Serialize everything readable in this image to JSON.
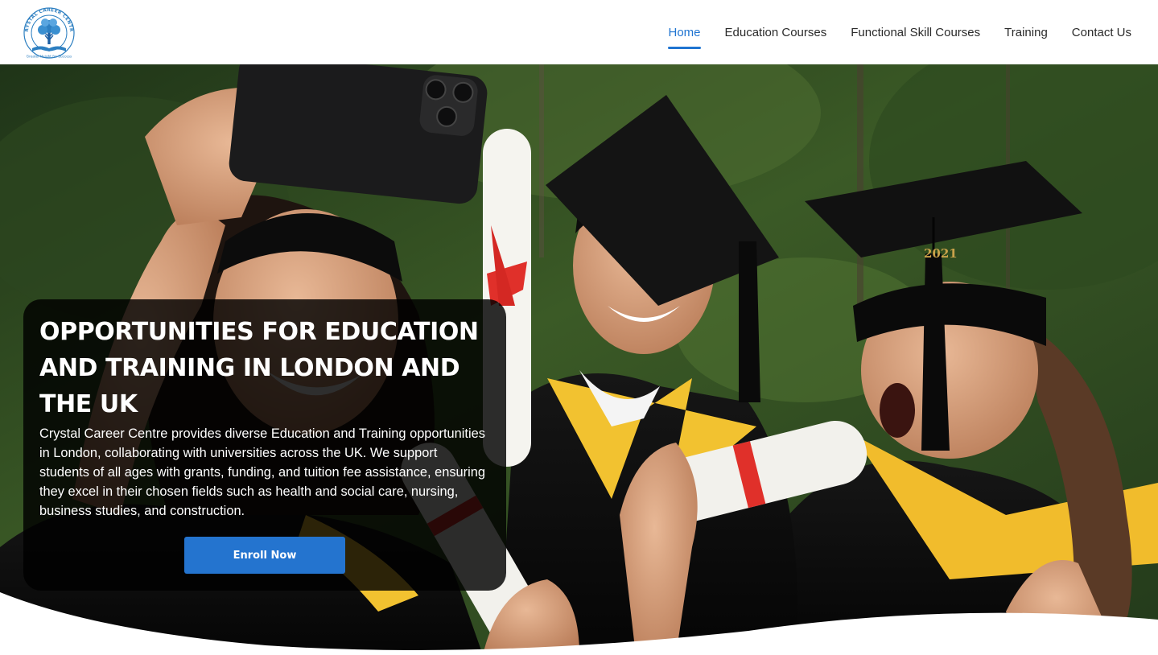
{
  "logo": {
    "ring_text": "CRYSTAL CAREER CENTRE",
    "tagline": "Greater Height for Success"
  },
  "nav": {
    "items": [
      {
        "label": "Home",
        "active": true
      },
      {
        "label": "Education Courses",
        "active": false
      },
      {
        "label": "Functional Skill Courses",
        "active": false
      },
      {
        "label": "Training",
        "active": false
      },
      {
        "label": "Contact Us",
        "active": false
      }
    ]
  },
  "hero": {
    "title": "OPPORTUNITIES FOR EDUCATION AND TRAINING IN LONDON AND THE UK",
    "description": "Crystal Career Centre provides diverse Education and Training opportunities in London, collaborating with universities across the UK. We support students of all ages with grants, funding, and tuition fee assistance, ensuring they excel in their chosen fields such as health and social care, nursing, business studies, and construction.",
    "button_label": "Enroll Now",
    "cap_tassel_text": "2021"
  },
  "colors": {
    "accent": "#1f74d1",
    "button": "#2474cf",
    "nav_text": "#2a2a2a",
    "card_bg": "rgba(0,0,0,0.82)"
  }
}
